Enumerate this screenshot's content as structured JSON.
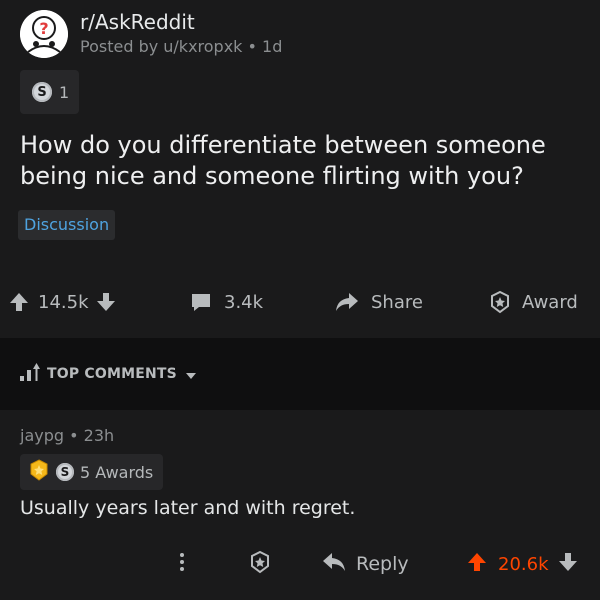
{
  "post": {
    "subreddit": "r/AskReddit",
    "posted_by": "Posted by u/kxropxk • 1d",
    "award_count": "1",
    "silver_symbol": "S",
    "title": "How do you differentiate between someone being nice and someone flirting with you?",
    "flair": "Discussion",
    "flair_color": "#4fa3e0"
  },
  "actions": {
    "upvotes": "14.5k",
    "comments": "3.4k",
    "share": "Share",
    "award": "Award"
  },
  "sort": {
    "label": "TOP COMMENTS"
  },
  "comment": {
    "meta": "jaypg • 23h",
    "awards_label": "5 Awards",
    "body": "Usually years later and with regret.",
    "reply": "Reply",
    "votes": "20.6k",
    "vote_color": "#ff4500"
  },
  "icons": {
    "avatar": "askreddit-logo-icon",
    "upvote": "arrow-up-icon",
    "downvote": "arrow-down-icon",
    "comment": "comment-bubble-icon",
    "share": "share-arrow-icon",
    "award": "award-star-icon",
    "sort": "sort-bars-icon",
    "more": "vertical-dots-icon",
    "reply": "reply-arrow-icon"
  }
}
